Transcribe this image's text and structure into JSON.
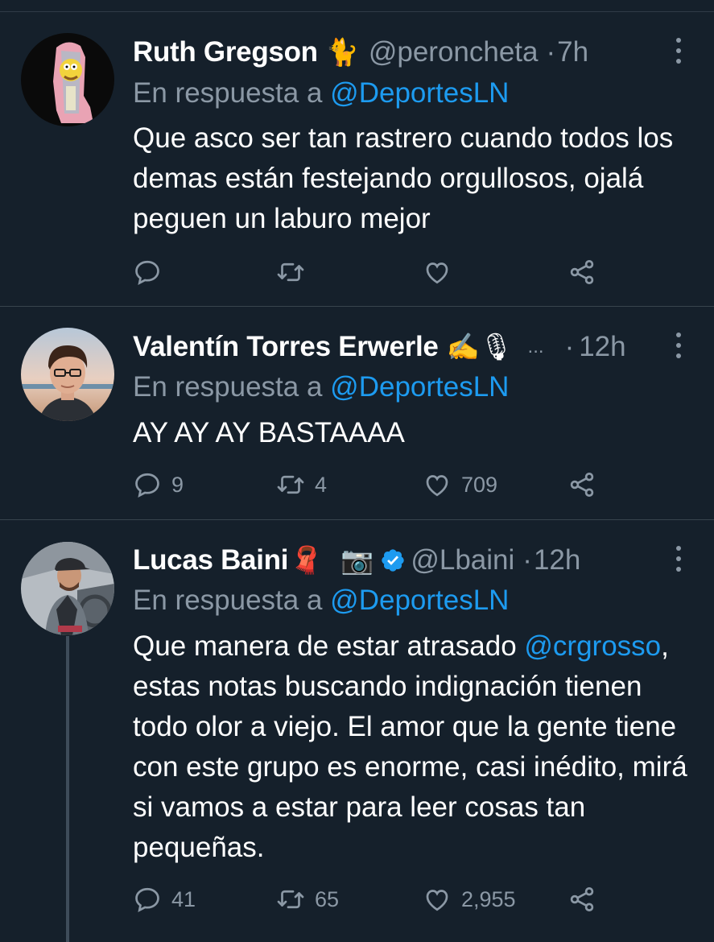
{
  "colors": {
    "background": "#15202b",
    "accent": "#1d9bf0",
    "muted": "#8b98a5",
    "divider": "#38444d"
  },
  "tweets": [
    {
      "name": "Ruth Gregson",
      "emoji": "🐈",
      "handle": "@peroncheta",
      "time": "7h",
      "reply_prefix": "En respuesta a",
      "reply_to": "@DeportesLN",
      "text": "Que asco ser tan rastrero cuando todos los demas están festejando orgullosos, ojalá peguen un laburo mejor",
      "replies": "",
      "retweets": "",
      "likes": ""
    },
    {
      "name": "Valentín Torres Erwerle",
      "emoji": "✍️🎙",
      "handle": "...",
      "time": "12h",
      "reply_prefix": "En respuesta a",
      "reply_to": "@DeportesLN",
      "text": "AY AY AY BASTAAAA",
      "replies": "9",
      "retweets": "4",
      "likes": "709"
    },
    {
      "name": "Lucas Baini",
      "emoji": "🧣",
      "emoji2": "📷",
      "verified": true,
      "handle": "@Lbaini",
      "time": "12h",
      "reply_prefix": "En respuesta a",
      "reply_to": "@DeportesLN",
      "text_part1": "Que manera de estar atrasado",
      "text_mention": "@crgrosso",
      "text_part2": ", estas notas buscando indignación tienen todo olor a viejo. El amor que la gente tiene con este grupo es enorme, casi inédito, mirá si vamos a estar para leer cosas tan pequeñas.",
      "replies": "41",
      "retweets": "65",
      "likes": "2,955"
    }
  ],
  "icons": [
    "reply-icon",
    "retweet-icon",
    "like-icon",
    "share-icon",
    "more-icon",
    "verified-icon"
  ]
}
